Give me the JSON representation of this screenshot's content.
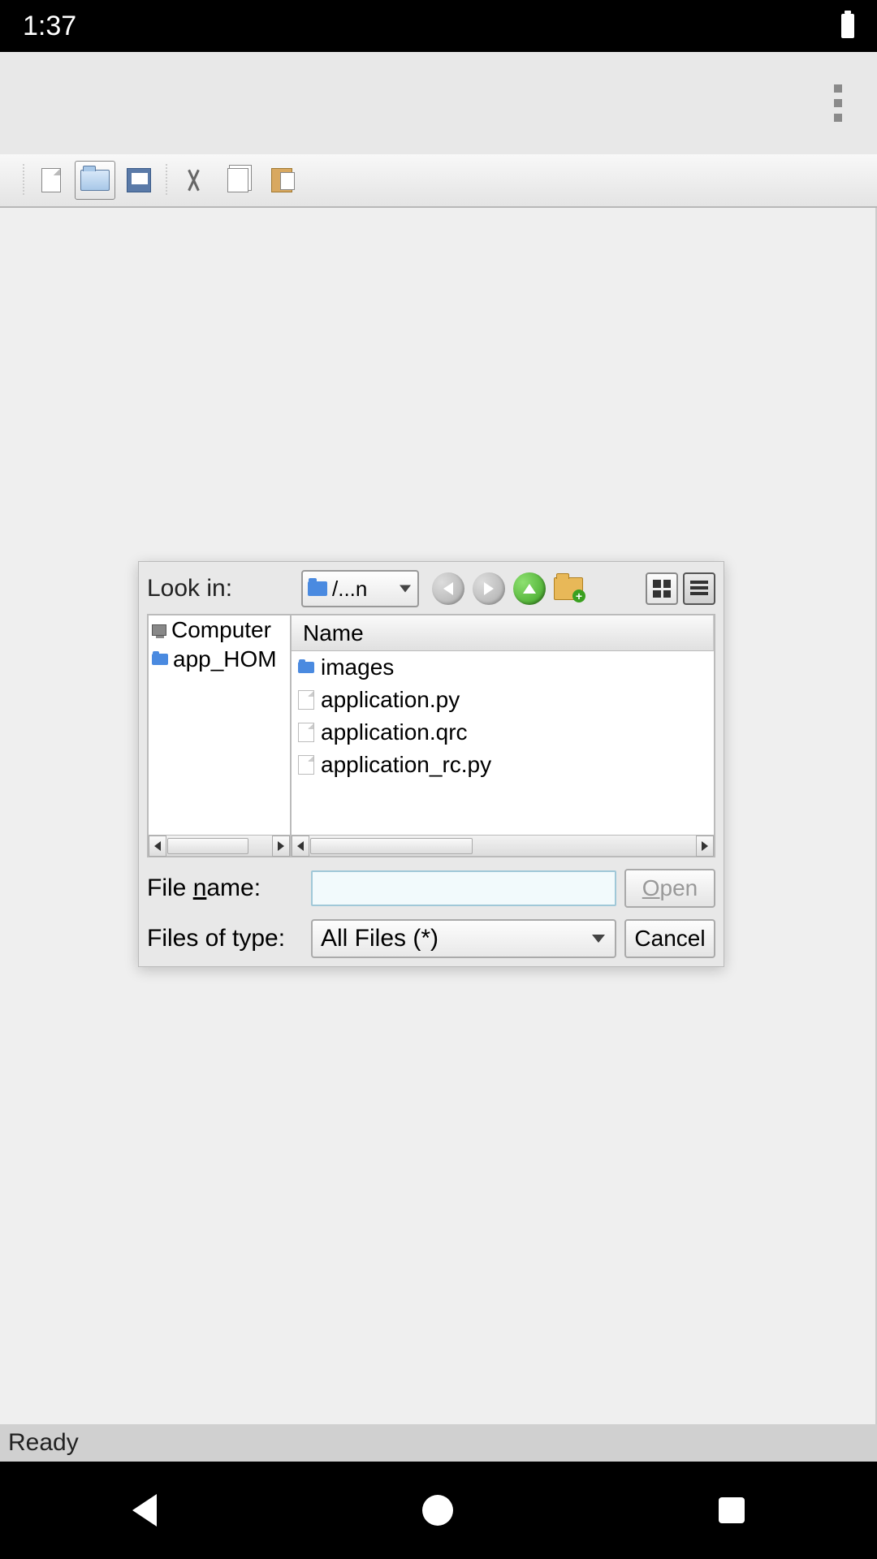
{
  "status": {
    "time": "1:37"
  },
  "toolbar": {
    "items": [
      "new",
      "open",
      "save",
      "cut",
      "copy",
      "paste"
    ]
  },
  "dialog": {
    "look_in_label": "Look in:",
    "look_in_value": "/...n",
    "tree": {
      "items": [
        "Computer",
        "app_HOM"
      ]
    },
    "list": {
      "header": "Name",
      "files": [
        {
          "name": "images",
          "type": "folder"
        },
        {
          "name": "application.py",
          "type": "file"
        },
        {
          "name": "application.qrc",
          "type": "file"
        },
        {
          "name": "application_rc.py",
          "type": "file"
        }
      ]
    },
    "file_name_label_pre": "File ",
    "file_name_label_u": "n",
    "file_name_label_post": "ame:",
    "file_name_value": "",
    "files_of_type_label": "Files of type:",
    "files_of_type_value": "All Files (*)",
    "open_label_u": "O",
    "open_label_post": "pen",
    "cancel_label": "Cancel"
  },
  "app_status": "Ready"
}
